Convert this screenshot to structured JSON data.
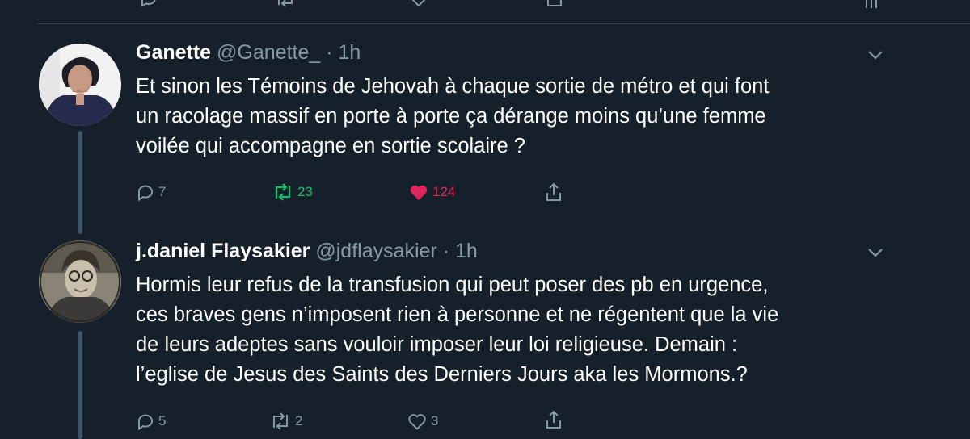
{
  "colors": {
    "background": "#15202b",
    "text_secondary": "#8899a6",
    "retweet_active": "#17bf63",
    "like_active": "#e0245e",
    "divider": "#38444d"
  },
  "tweets": [
    {
      "display_name": "Ganette",
      "handle": "@Ganette_",
      "separator": "·",
      "time": "1h",
      "text_lines": [
        "Et sinon les Témoins de Jehovah à chaque sortie de métro et qui font",
        "un racolage massif en porte à porte ça dérange moins qu’une femme",
        "voilée qui accompagne en sortie scolaire ?"
      ],
      "reply_count": "7",
      "retweet_count": "23",
      "like_count": "124",
      "retweeted": true,
      "liked": true,
      "icons": [
        "reply-icon",
        "retweet-icon",
        "like-icon",
        "share-icon",
        "chevron-down-icon"
      ]
    },
    {
      "display_name": "j.daniel Flaysakier",
      "handle": "@jdflaysakier",
      "separator": "·",
      "time": "1h",
      "text_lines": [
        "Hormis leur refus de la transfusion qui peut poser des pb en urgence,",
        "ces braves gens n’imposent rien à personne et ne régentent que la vie",
        "de leurs adeptes sans vouloir imposer leur loi religieuse. Demain :",
        "l’eglise de Jesus des Saints des Derniers Jours aka les Mormons.?"
      ],
      "reply_count": "5",
      "retweet_count": "2",
      "like_count": "3",
      "retweeted": false,
      "liked": false,
      "icons": [
        "reply-icon",
        "retweet-icon",
        "like-icon",
        "share-icon",
        "chevron-down-icon"
      ]
    }
  ]
}
